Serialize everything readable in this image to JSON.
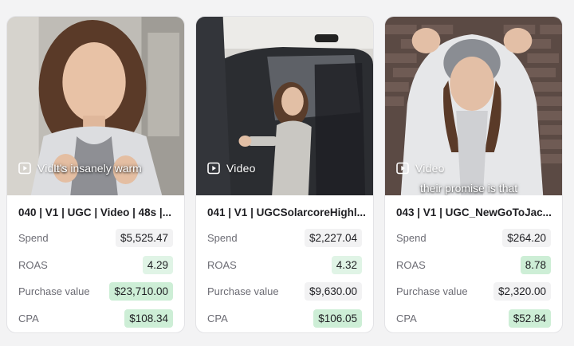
{
  "cards": [
    {
      "title": "040 | V1 | UGC | Video | 48s |...",
      "media_label": "Video",
      "caption": "It's insanely warm",
      "metrics": [
        {
          "label": "Spend",
          "value": "$5,525.47",
          "highlight": "none"
        },
        {
          "label": "ROAS",
          "value": "4.29",
          "highlight": "light"
        },
        {
          "label": "Purchase value",
          "value": "$23,710.00",
          "highlight": "strong"
        },
        {
          "label": "CPA",
          "value": "$108.34",
          "highlight": "strong"
        }
      ]
    },
    {
      "title": "041 | V1 | UGCSolarcoreHighl...",
      "media_label": "Video",
      "caption": "",
      "metrics": [
        {
          "label": "Spend",
          "value": "$2,227.04",
          "highlight": "none"
        },
        {
          "label": "ROAS",
          "value": "4.32",
          "highlight": "light"
        },
        {
          "label": "Purchase value",
          "value": "$9,630.00",
          "highlight": "none"
        },
        {
          "label": "CPA",
          "value": "$106.05",
          "highlight": "strong"
        }
      ]
    },
    {
      "title": "043 | V1 | UGC_NewGoToJac...",
      "media_label": "Video",
      "caption": "their promise is that",
      "metrics": [
        {
          "label": "Spend",
          "value": "$264.20",
          "highlight": "none"
        },
        {
          "label": "ROAS",
          "value": "8.78",
          "highlight": "strong"
        },
        {
          "label": "Purchase value",
          "value": "$2,320.00",
          "highlight": "none"
        },
        {
          "label": "CPA",
          "value": "$52.84",
          "highlight": "strong"
        }
      ]
    }
  ],
  "colors": {
    "highlight_strong": "#cdeed6",
    "highlight_light": "#e0f4e6",
    "neutral_value_bg": "#f2f2f3"
  },
  "icons": {
    "media_type": "video-play-icon"
  }
}
